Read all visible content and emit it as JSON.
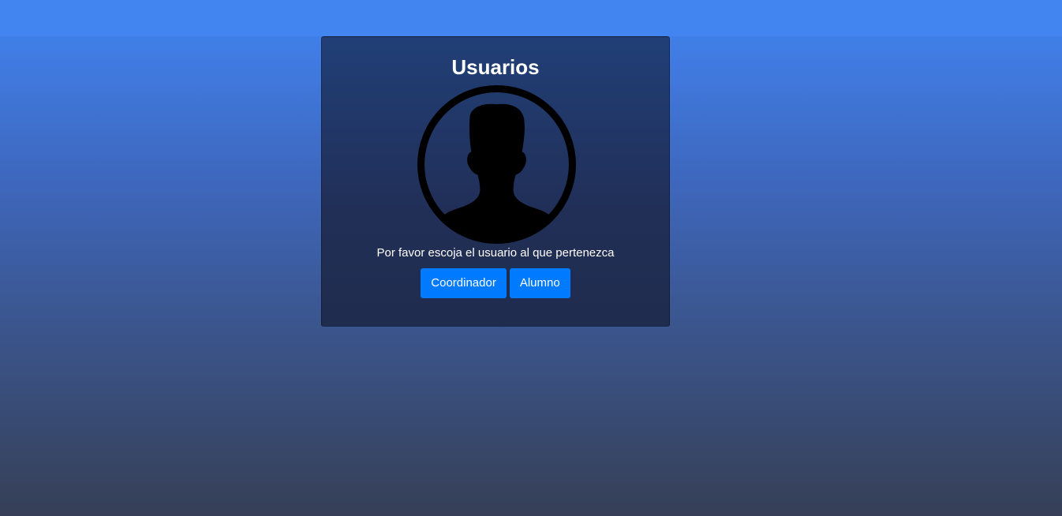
{
  "card": {
    "title": "Usuarios",
    "avatar_icon": "user-silhouette-icon",
    "prompt": "Por favor escoja el usuario al que pertenezca"
  },
  "buttons": {
    "coordinator_label": "Coordinador",
    "student_label": "Alumno"
  },
  "colors": {
    "topbar": "#4285f0",
    "card_background": "#213f77",
    "button_primary": "#007bff",
    "avatar": "#000000"
  }
}
